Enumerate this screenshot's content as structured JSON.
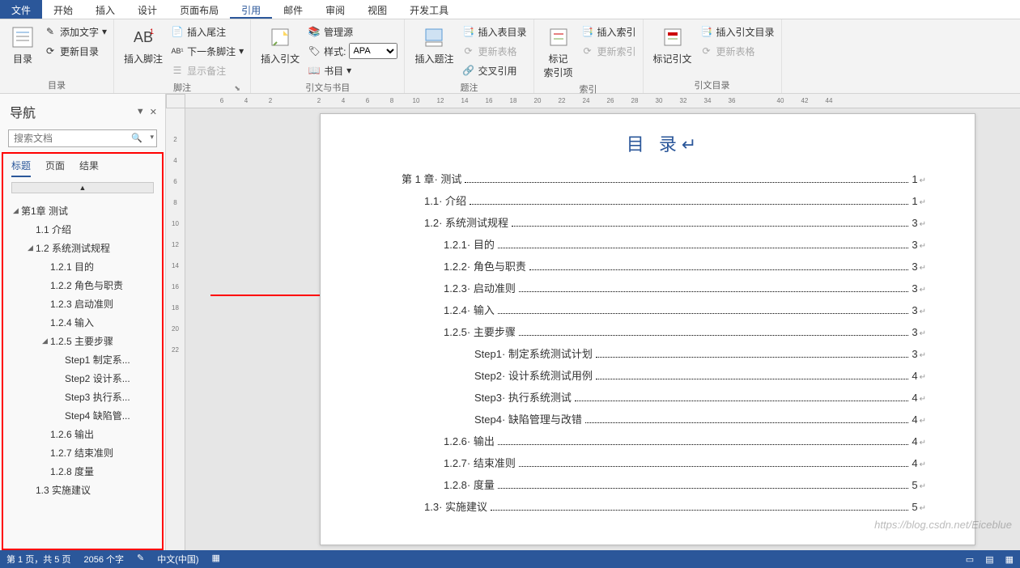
{
  "menubar": {
    "file": "文件",
    "tabs": [
      "开始",
      "插入",
      "设计",
      "页面布局",
      "引用",
      "邮件",
      "审阅",
      "视图",
      "开发工具"
    ],
    "active": "引用"
  },
  "ribbon": {
    "groups": {
      "toc": {
        "label": "目录",
        "toc_btn": "目录",
        "add_text": "添加文字",
        "update_toc": "更新目录"
      },
      "footnotes": {
        "label": "脚注",
        "insert_fn": "插入脚注",
        "insert_en": "插入尾注",
        "next_fn": "下一条脚注",
        "show_notes": "显示备注"
      },
      "citations": {
        "label": "引文与书目",
        "insert_cit": "插入引文",
        "manage_src": "管理源",
        "style_lbl": "样式:",
        "style_val": "APA",
        "biblio": "书目"
      },
      "captions": {
        "label": "题注",
        "insert_cap": "插入题注",
        "insert_fig_toc": "插入表目录",
        "update_tbl": "更新表格",
        "crossref": "交叉引用"
      },
      "index": {
        "label": "索引",
        "mark_entry": "标记\n索引项",
        "insert_idx": "插入索引",
        "update_idx": "更新索引"
      },
      "toa": {
        "label": "引文目录",
        "mark_cit": "标记引文",
        "insert_toa": "插入引文目录",
        "update_tbl2": "更新表格"
      }
    }
  },
  "nav": {
    "title": "导航",
    "search_ph": "搜索文档",
    "tabs": [
      "标题",
      "页面",
      "结果"
    ],
    "tree": [
      {
        "lvl": 1,
        "exp": true,
        "t": "第1章 测试"
      },
      {
        "lvl": 2,
        "t": "1.1 介绍"
      },
      {
        "lvl": 2,
        "exp": true,
        "t": "1.2 系统测试规程"
      },
      {
        "lvl": 3,
        "t": "1.2.1 目的"
      },
      {
        "lvl": 3,
        "t": "1.2.2 角色与职责"
      },
      {
        "lvl": 3,
        "t": "1.2.3 启动准则"
      },
      {
        "lvl": 3,
        "t": "1.2.4 输入"
      },
      {
        "lvl": 3,
        "exp": true,
        "t": "1.2.5 主要步骤"
      },
      {
        "lvl": 4,
        "t": "Step1 制定系..."
      },
      {
        "lvl": 4,
        "t": "Step2 设计系..."
      },
      {
        "lvl": 4,
        "t": "Step3 执行系..."
      },
      {
        "lvl": 4,
        "t": "Step4 缺陷管..."
      },
      {
        "lvl": 3,
        "t": "1.2.6 输出"
      },
      {
        "lvl": 3,
        "t": "1.2.7 结束准则"
      },
      {
        "lvl": 3,
        "t": "1.2.8 度量"
      },
      {
        "lvl": 2,
        "t": "1.3 实施建议"
      }
    ]
  },
  "hruler": [
    "",
    "6",
    "4",
    "2",
    "",
    "2",
    "4",
    "6",
    "8",
    "10",
    "12",
    "14",
    "16",
    "18",
    "20",
    "22",
    "24",
    "26",
    "28",
    "30",
    "32",
    "34",
    "36",
    "",
    "40",
    "42",
    "44"
  ],
  "vruler": [
    "",
    "2",
    "4",
    "6",
    "8",
    "10",
    "12",
    "14",
    "16",
    "18",
    "20",
    "22"
  ],
  "toc": {
    "title": "目 录",
    "rows": [
      {
        "ind": 0,
        "t": "第 1 章· 测试",
        "p": "1"
      },
      {
        "ind": 1,
        "t": "1.1· 介绍",
        "p": "1"
      },
      {
        "ind": 1,
        "t": "1.2· 系统测试规程",
        "p": "3"
      },
      {
        "ind": 2,
        "t": "1.2.1· 目的",
        "p": "3"
      },
      {
        "ind": 2,
        "t": "1.2.2· 角色与职责",
        "p": "3"
      },
      {
        "ind": 2,
        "t": "1.2.3· 启动准则",
        "p": "3"
      },
      {
        "ind": 2,
        "t": "1.2.4· 输入",
        "p": "3"
      },
      {
        "ind": 2,
        "t": "1.2.5· 主要步骤",
        "p": "3"
      },
      {
        "ind": 3,
        "t": "Step1· 制定系统测试计划",
        "p": "3"
      },
      {
        "ind": 3,
        "t": "Step2· 设计系统测试用例",
        "p": "4"
      },
      {
        "ind": 3,
        "t": "Step3· 执行系统测试",
        "p": "4"
      },
      {
        "ind": 3,
        "t": "Step4· 缺陷管理与改错",
        "p": "4"
      },
      {
        "ind": 2,
        "t": "1.2.6· 输出",
        "p": "4"
      },
      {
        "ind": 2,
        "t": "1.2.7· 结束准则",
        "p": "4"
      },
      {
        "ind": 2,
        "t": "1.2.8· 度量",
        "p": "5"
      },
      {
        "ind": 1,
        "t": "1.3· 实施建议",
        "p": "5"
      }
    ]
  },
  "status": {
    "page": "第 1 页，共 5 页",
    "words": "2056 个字",
    "lang": "中文(中国)"
  },
  "watermark": "https://blog.csdn.net/Eiceblue"
}
